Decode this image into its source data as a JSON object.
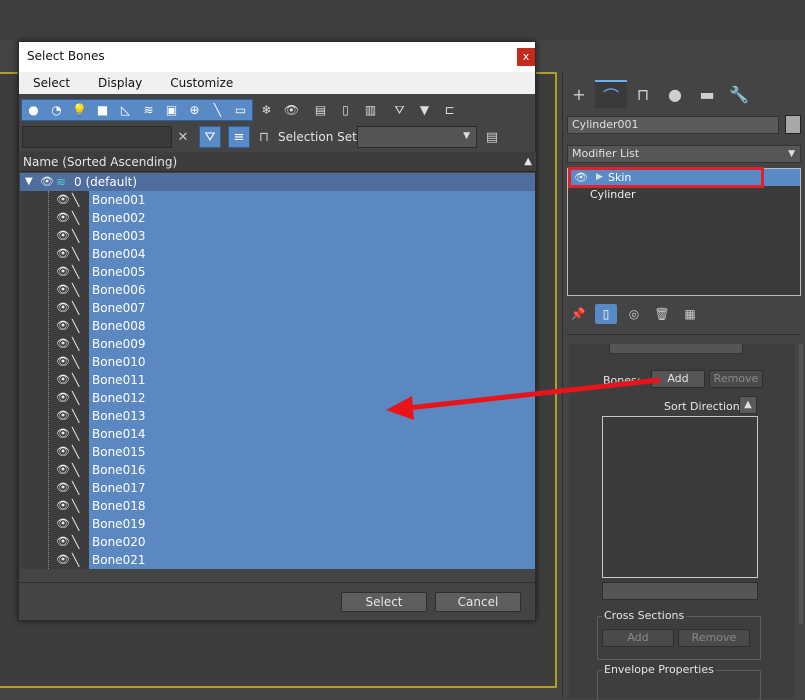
{
  "dialog": {
    "title": "Select Bones",
    "close_glyph": "x",
    "menus": [
      "Select",
      "Display",
      "Customize"
    ],
    "selection_set_label": "Selection Set:",
    "column_header": "Name (Sorted Ascending)",
    "root_layer": "0 (default)",
    "bones": [
      "Bone001",
      "Bone002",
      "Bone003",
      "Bone004",
      "Bone005",
      "Bone006",
      "Bone007",
      "Bone008",
      "Bone009",
      "Bone010",
      "Bone011",
      "Bone012",
      "Bone013",
      "Bone014",
      "Bone015",
      "Bone016",
      "Bone017",
      "Bone018",
      "Bone019",
      "Bone020",
      "Bone021"
    ],
    "select_button": "Select",
    "cancel_button": "Cancel"
  },
  "command_panel": {
    "object_name": "Cylinder001",
    "modifier_list": "Modifier List",
    "stack": [
      "Skin",
      "Cylinder"
    ],
    "bones_label": "Bones:",
    "add_button": "Add",
    "remove_button": "Remove",
    "sort_direction_label": "Sort Direction:",
    "cross_sections_title": "Cross Sections",
    "cs_add_button": "Add",
    "cs_remove_button": "Remove",
    "envelope_title": "Envelope Properties"
  },
  "colors": {
    "selection_blue": "#5b88c0",
    "highlight_red": "#e0202a",
    "viewport_border": "#b79b2a"
  }
}
